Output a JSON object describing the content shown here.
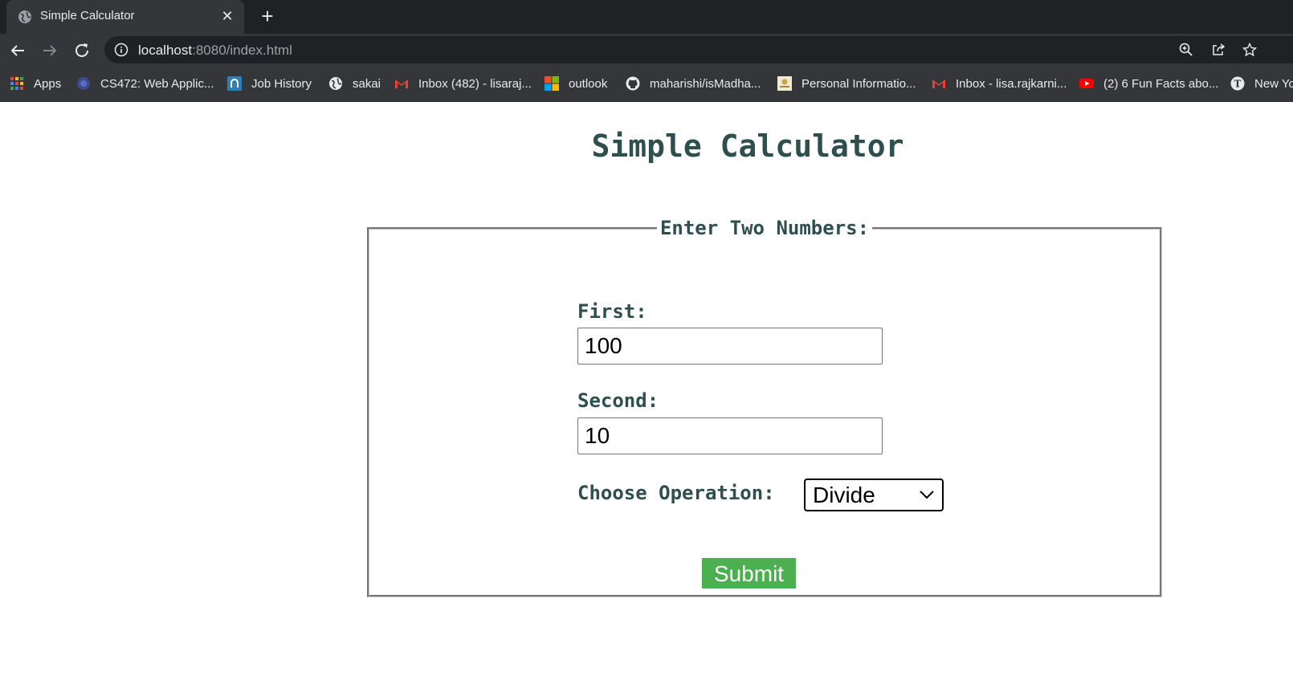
{
  "browser": {
    "tab": {
      "title": "Simple Calculator",
      "favicon": "globe-icon"
    },
    "url": {
      "host": "localhost",
      "rest": ":8080/index.html"
    },
    "bookmarks": [
      {
        "label": "Apps",
        "icon": "apps-grid-icon"
      },
      {
        "label": "CS472: Web Applic...",
        "icon": "globe-icon"
      },
      {
        "label": "Job History",
        "icon": "job-history-icon"
      },
      {
        "label": "sakai",
        "icon": "globe-icon"
      },
      {
        "label": "Inbox (482) - lisaraj...",
        "icon": "gmail-icon"
      },
      {
        "label": "outlook",
        "icon": "microsoft-icon"
      },
      {
        "label": "maharishi/isMadha...",
        "icon": "github-icon"
      },
      {
        "label": "Personal Informatio...",
        "icon": "document-icon"
      },
      {
        "label": "Inbox - lisa.rajkarni...",
        "icon": "gmail-icon"
      },
      {
        "label": "(2) 6 Fun Facts abo...",
        "icon": "youtube-icon"
      },
      {
        "label": "New Yo",
        "icon": "nyt-icon"
      }
    ]
  },
  "page": {
    "title": "Simple Calculator",
    "legend": "Enter Two Numbers:",
    "first": {
      "label": "First:",
      "value": "100"
    },
    "second": {
      "label": "Second:",
      "value": "10"
    },
    "operation": {
      "label": "Choose Operation:",
      "selected": "Divide"
    },
    "submit_label": "Submit"
  },
  "colors": {
    "heading": "#2f4f4f",
    "submit_bg": "#4caf50",
    "chrome_dark": "#202124",
    "chrome_toolbar": "#35363a"
  }
}
